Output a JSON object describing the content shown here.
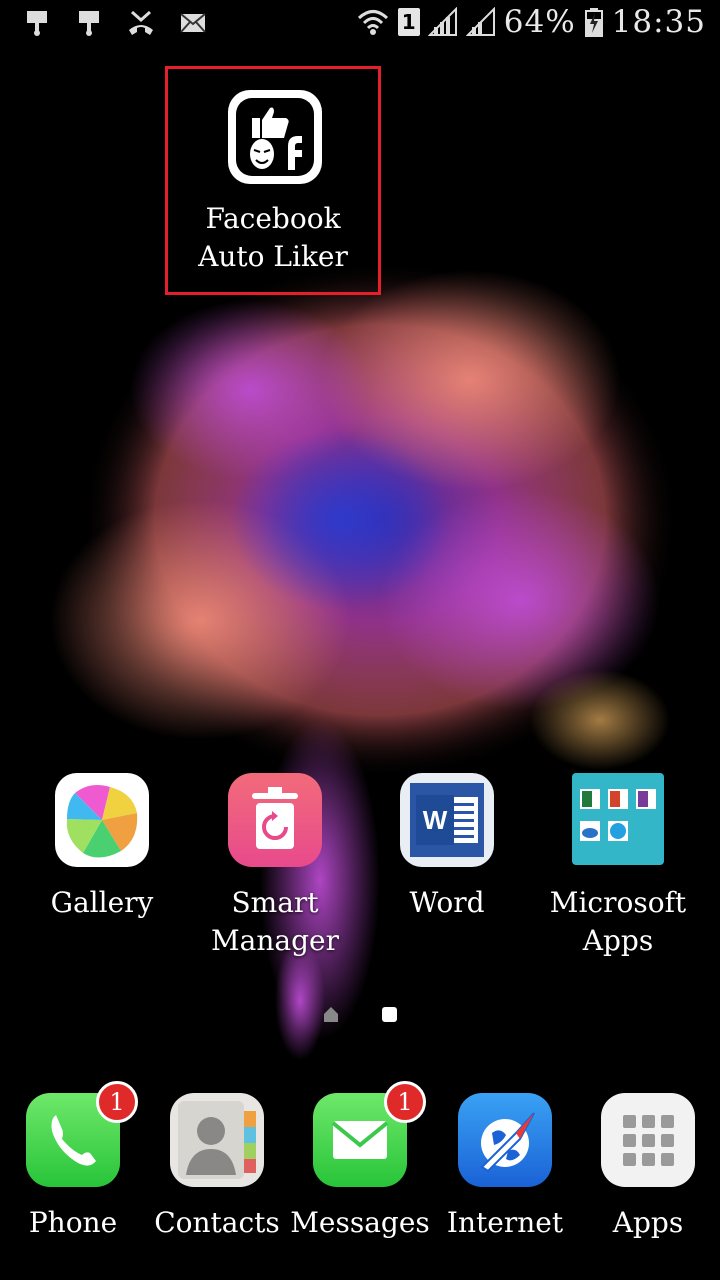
{
  "status_bar": {
    "battery": "64%",
    "time": "18:35",
    "sim_slot": "1",
    "left_icons": [
      "usb-icon",
      "usb-icon",
      "missed-call-icon",
      "mail-icon"
    ],
    "right_icons": [
      "wifi-icon",
      "sim-icon",
      "signal-icon",
      "signal-icon",
      "battery-charging-icon"
    ]
  },
  "highlighted_app": {
    "label": "Facebook Auto Liker",
    "icon": "facebook-auto-liker-icon",
    "highlight_color": "#e5202a"
  },
  "home_apps": [
    {
      "label": "Gallery",
      "icon": "gallery-icon"
    },
    {
      "label": "Smart Manager",
      "icon": "smart-manager-icon"
    },
    {
      "label": "Word",
      "icon": "word-icon"
    },
    {
      "label": "Microsoft Apps",
      "icon": "microsoft-apps-folder-icon"
    }
  ],
  "page_indicator": {
    "pages": [
      "home",
      "page"
    ],
    "current_index": 1
  },
  "dock": [
    {
      "label": "Phone",
      "icon": "phone-icon",
      "badge": "1"
    },
    {
      "label": "Contacts",
      "icon": "contacts-icon"
    },
    {
      "label": "Messages",
      "icon": "messages-icon",
      "badge": "1"
    },
    {
      "label": "Internet",
      "icon": "internet-icon"
    },
    {
      "label": "Apps",
      "icon": "apps-grid-icon"
    }
  ]
}
